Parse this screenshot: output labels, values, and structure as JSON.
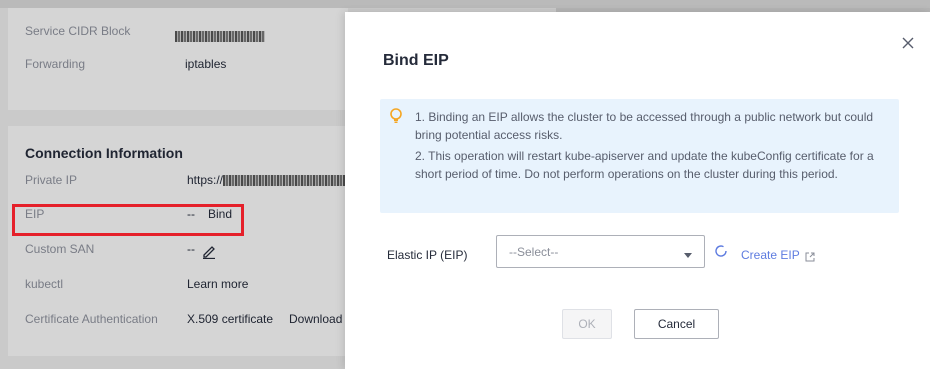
{
  "background": {
    "basic": {
      "service_cidr_label": "Service CIDR Block",
      "forwarding_label": "Forwarding",
      "forwarding_value": "iptables"
    },
    "connection": {
      "title": "Connection Information",
      "private_ip_label": "Private IP",
      "private_ip_prefix": "https://",
      "eip_label": "EIP",
      "eip_value": "--",
      "eip_bind_link": "Bind",
      "custom_san_label": "Custom SAN",
      "custom_san_value": "--",
      "kubectl_label": "kubectl",
      "kubectl_link": "Learn more",
      "cert_auth_label": "Certificate Authentication",
      "cert_auth_value": "X.509 certificate",
      "cert_download_link": "Download"
    }
  },
  "dialog": {
    "title": "Bind EIP",
    "alert_line1": "1. Binding an EIP allows the cluster to be accessed through a public network but could bring potential access risks.",
    "alert_line2": "2. This operation will restart kube-apiserver and update the kubeConfig certificate for a short period of time. Do not perform operations on the cluster during this period.",
    "eip_field_label": "Elastic IP (EIP)",
    "eip_select_placeholder": "--Select--",
    "create_eip_link": "Create EIP",
    "ok_label": "OK",
    "cancel_label": "Cancel"
  },
  "colors": {
    "accent": "#5e7ce0",
    "highlight_border": "#e5202a",
    "alert_bg": "#e8f3fd",
    "tip_icon": "#f5a623"
  },
  "icons": [
    "close-icon",
    "lightbulb-icon",
    "chevron-down-icon",
    "refresh-icon",
    "external-link-icon",
    "pencil-icon"
  ]
}
